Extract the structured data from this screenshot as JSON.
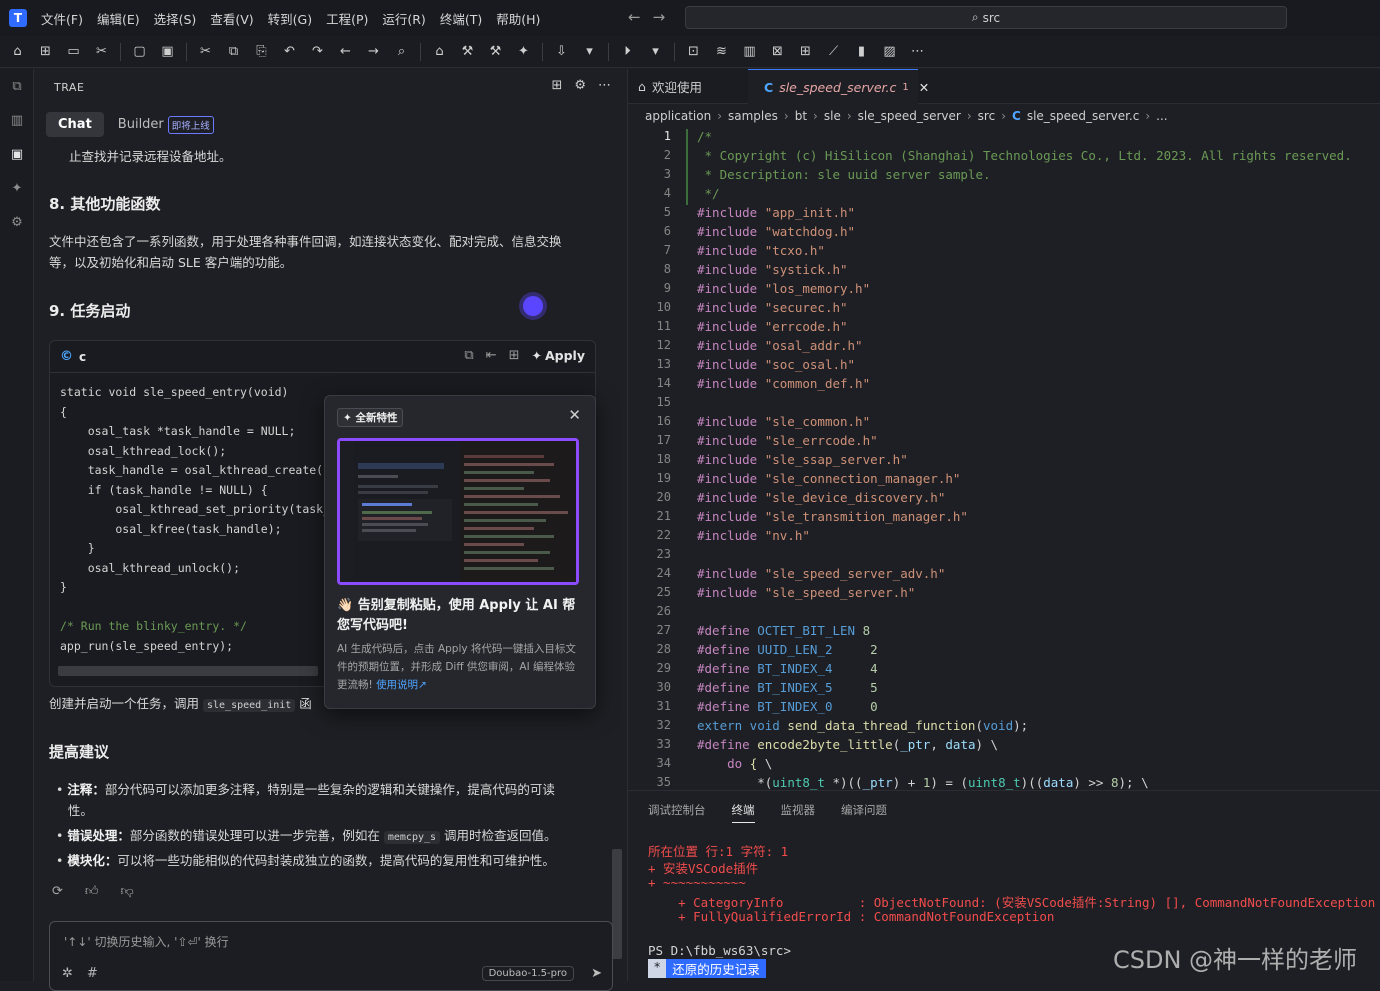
{
  "menu": {
    "items": [
      "文件(F)",
      "编辑(E)",
      "选择(S)",
      "查看(V)",
      "转到(G)",
      "工程(P)",
      "运行(R)",
      "终端(T)",
      "帮助(H)"
    ],
    "search_text": "src"
  },
  "chat": {
    "header": "TRAE",
    "tab_chat": "Chat",
    "tab_builder": "Builder",
    "builder_badge": "即将上线",
    "line_top": "止查找并记录远程设备地址。",
    "h8": "8. 其他功能函数",
    "p8_1": "文件中还包含了一系列函数，用于处理各种事件回调，如连接状态变化、配对完成、信息交换",
    "p8_2": "等，以及初始化和启动 SLE 客户端的功能。",
    "h9": "9. 任务启动",
    "code_lang": "c",
    "apply_label": "Apply",
    "code_lines": [
      "static void sle_speed_entry(void)",
      "{",
      "    osal_task *task_handle = NULL;",
      "    osal_kthread_lock();",
      "    task_handle = osal_kthread_create((o",
      "    if (task_handle != NULL) {",
      "        osal_kthread_set_priority(task_h",
      "        osal_kfree(task_handle);",
      "    }",
      "    osal_kthread_unlock();",
      "}",
      "",
      "/* Run the blinky_entry. */",
      "app_run(sle_speed_entry);"
    ],
    "after_code": "创建并启动一个任务，调用",
    "after_code_inline": "sle_speed_init",
    "after_code_tail": "函",
    "h_suggest": "提高建议",
    "bullets": [
      {
        "bold": "注释：",
        "text": "部分代码可以添加更多注释，特别是一些复杂的逻辑和关键操作，提高代码的可读",
        "text2": "性。"
      },
      {
        "bold": "错误处理：",
        "text": "部分函数的错误处理可以进一步完善，例如在",
        "inline": "memcpy_s",
        "tail": "调用时检查返回值。"
      },
      {
        "bold": "模块化：",
        "text": "可以将一些功能相似的代码封装成独立的函数，提高代码的复用性和可维护性。"
      }
    ],
    "input_placeholder": "'↑↓' 切换历史输入, '⇧⏎' 换行",
    "model": "Doubao-1.5-pro"
  },
  "popup": {
    "tag": "全新特性",
    "title": "👋🏻 告别复制粘贴，使用 Apply 让 AI 帮您写代码吧!",
    "desc": "AI 生成代码后，点击 Apply 将代码一键插入目标文件的预期位置，并形成 Diff 供您审阅，AI 编程体验更流畅!",
    "link": "使用说明↗"
  },
  "editor": {
    "tab_welcome": "欢迎使用",
    "tab_file": "sle_speed_server.c",
    "tab_file_badge": "1",
    "breadcrumb": [
      "application",
      "samples",
      "bt",
      "sle",
      "sle_speed_server",
      "src",
      "sle_speed_server.c",
      "..."
    ],
    "lines": [
      {
        "n": 1,
        "t": "/*",
        "c": "cm"
      },
      {
        "n": 2,
        "t": " * Copyright (c) HiSilicon (Shanghai) Technologies Co., Ltd. 2023. All rights reserved.",
        "c": "cm"
      },
      {
        "n": 3,
        "t": " * Description: sle uuid server sample.",
        "c": "cm"
      },
      {
        "n": 4,
        "t": " */",
        "c": "cm"
      },
      {
        "n": 5,
        "inc": "\"app_init.h\""
      },
      {
        "n": 6,
        "inc": "\"watchdog.h\""
      },
      {
        "n": 7,
        "inc": "\"tcxo.h\""
      },
      {
        "n": 8,
        "inc": "\"systick.h\""
      },
      {
        "n": 9,
        "inc": "\"los_memory.h\""
      },
      {
        "n": 10,
        "inc": "\"securec.h\""
      },
      {
        "n": 11,
        "inc": "\"errcode.h\""
      },
      {
        "n": 12,
        "inc": "\"osal_addr.h\""
      },
      {
        "n": 13,
        "inc": "\"soc_osal.h\""
      },
      {
        "n": 14,
        "inc": "\"common_def.h\""
      },
      {
        "n": 15,
        "t": ""
      },
      {
        "n": 16,
        "inc": "\"sle_common.h\""
      },
      {
        "n": 17,
        "inc": "\"sle_errcode.h\""
      },
      {
        "n": 18,
        "inc": "\"sle_ssap_server.h\""
      },
      {
        "n": 19,
        "inc": "\"sle_connection_manager.h\""
      },
      {
        "n": 20,
        "inc": "\"sle_device_discovery.h\""
      },
      {
        "n": 21,
        "inc": "\"sle_transmition_manager.h\""
      },
      {
        "n": 22,
        "inc": "\"nv.h\""
      },
      {
        "n": 23,
        "t": ""
      },
      {
        "n": 24,
        "inc": "\"sle_speed_server_adv.h\""
      },
      {
        "n": 25,
        "inc": "\"sle_speed_server.h\""
      },
      {
        "n": 26,
        "t": ""
      },
      {
        "n": 27,
        "def": "OCTET_BIT_LEN",
        "val": "8",
        "pad": " "
      },
      {
        "n": 28,
        "def": "UUID_LEN_2",
        "val": "2",
        "pad": "     "
      },
      {
        "n": 29,
        "def": "BT_INDEX_4",
        "val": "4",
        "pad": "     "
      },
      {
        "n": 30,
        "def": "BT_INDEX_5",
        "val": "5",
        "pad": "     "
      },
      {
        "n": 31,
        "def": "BT_INDEX_0",
        "val": "0",
        "pad": "     "
      },
      {
        "n": 32,
        "extern": true
      },
      {
        "n": 33,
        "macro": true
      },
      {
        "n": 34,
        "do": true
      },
      {
        "n": 35,
        "deref": true
      }
    ]
  },
  "panel": {
    "tabs": [
      "调试控制台",
      "终端",
      "监视器",
      "编译问题"
    ],
    "term_lines": [
      "所在位置 行:1 字符: 1",
      "+ 安装VSCode插件",
      "+ ~~~~~~~~~~~",
      "    + CategoryInfo          : ObjectNotFound: (安装VSCode插件:String) [], CommandNotFoundException",
      "    + FullyQualifiedErrorId : CommandNotFoundException"
    ],
    "prompt": "PS D:\\fbb_ws63\\src>",
    "history_star": "*",
    "history_label": "还原的历史记录"
  },
  "watermark": "CSDN @神一样的老师"
}
